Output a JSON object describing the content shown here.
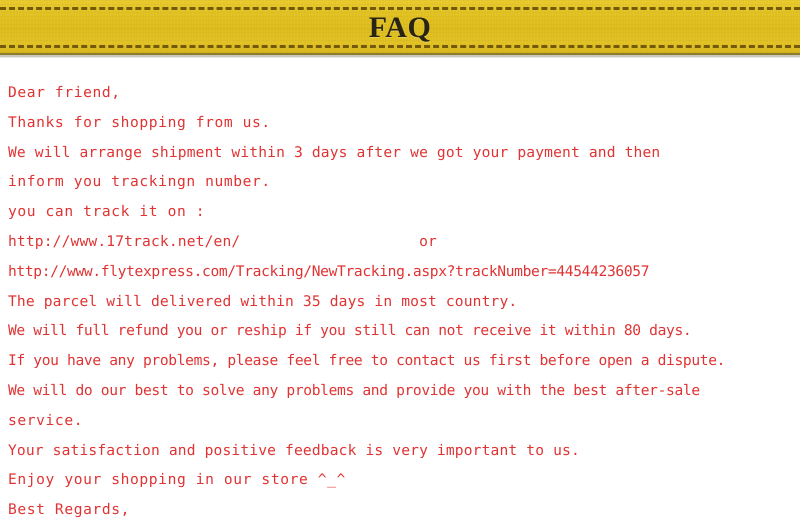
{
  "banner": {
    "title": "FAQ",
    "background_color": "#e2c222",
    "stitch_color": "#6e5508",
    "title_color": "#2a2412"
  },
  "body": {
    "text_color": "#e03434",
    "background_color": "#ffffff",
    "lines": [
      {
        "text": "Dear friend,",
        "spacing": "wide"
      },
      {
        "text": "Thanks for shopping from us.",
        "spacing": "wide"
      },
      {
        "text": "We will arrange shipment within 3 days after we got your payment and then",
        "spacing": "normal"
      },
      {
        "text": "inform you trackingn number.",
        "spacing": "wide"
      },
      {
        "text": "you can track it on :",
        "spacing": "wide"
      },
      {
        "text": "http://www.17track.net/en/                    or",
        "spacing": "normal"
      },
      {
        "text": "http://www.flytexpress.com/Tracking/NewTracking.aspx?trackNumber=44544236057",
        "spacing": "tight"
      },
      {
        "text": "The parcel will delivered within 35 days in most country.",
        "spacing": "normal"
      },
      {
        "text": "We will full refund you or reship if you still can not receive it within 80 days.",
        "spacing": "tight"
      },
      {
        "text": "If you have any problems, please feel free to contact us first before open a dispute.",
        "spacing": "tight"
      },
      {
        "text": "We will do our best to solve any problems and provide you with the best after-sale",
        "spacing": "tight"
      },
      {
        "text": "service.",
        "spacing": "wide"
      },
      {
        "text": "Your satisfaction and positive feedback is very important to us.",
        "spacing": "normal"
      },
      {
        "text": "Enjoy your shopping in our store ^_^",
        "spacing": "wide"
      },
      {
        "text": "Best Regards,",
        "spacing": "wide"
      }
    ]
  }
}
